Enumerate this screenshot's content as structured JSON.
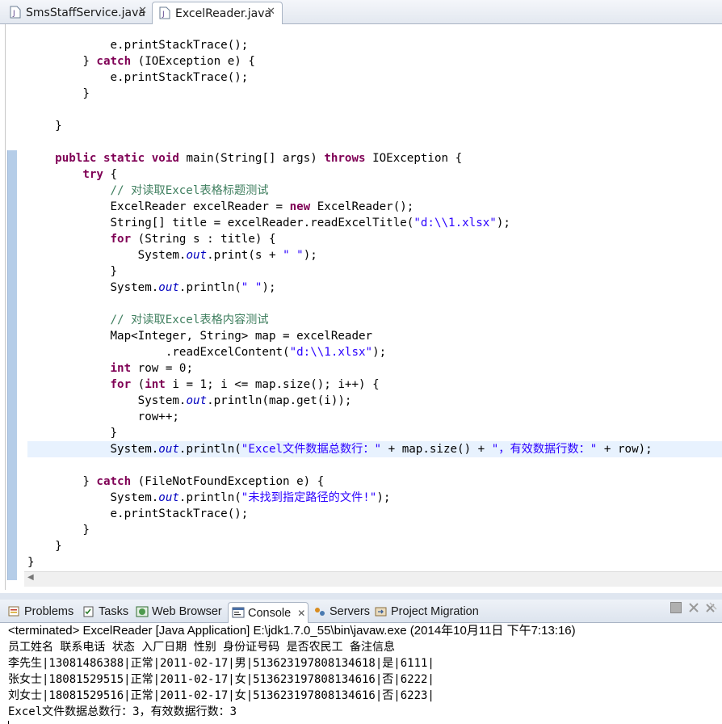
{
  "editor_tabs": [
    {
      "label": "SmsStaffService.java",
      "close": "✕",
      "icon": "java-file-icon",
      "active": false
    },
    {
      "label": "ExcelReader.java",
      "close": "✕",
      "icon": "java-file-icon",
      "active": true
    }
  ],
  "code_lines": [
    "            e.printStackTrace();",
    "        } catch (IOException e) {",
    "            e.printStackTrace();",
    "        }",
    "",
    "    }",
    "",
    "    public static void main(String[] args) throws IOException {",
    "        try {",
    "            // 对读取Excel表格标题测试",
    "            ExcelReader excelReader = new ExcelReader();",
    "            String[] title = excelReader.readExcelTitle(\"d:\\\\1.xlsx\");",
    "            for (String s : title) {",
    "                System.out.print(s + \" \");",
    "            }",
    "            System.out.println(\" \");",
    "",
    "            // 对读取Excel表格内容测试",
    "            Map<Integer, String> map = excelReader",
    "                    .readExcelContent(\"d:\\\\1.xlsx\");",
    "            int row = 0;",
    "            for (int i = 1; i <= map.size(); i++) {",
    "                System.out.println(map.get(i));",
    "                row++;",
    "            }",
    "            System.out.println(\"Excel文件数据总数行：\" + map.size() + \"，有效数据行数：\" + row);",
    "",
    "        } catch (FileNotFoundException e) {",
    "            System.out.println(\"未找到指定路径的文件!\");",
    "            e.printStackTrace();",
    "        }",
    "    }",
    "}"
  ],
  "highlighted_line": 25,
  "view_tabs": [
    {
      "label": "Problems",
      "icon": "problems-icon"
    },
    {
      "label": "Tasks",
      "icon": "tasks-icon"
    },
    {
      "label": "Web Browser",
      "icon": "web-browser-icon"
    },
    {
      "label": "Console",
      "icon": "console-icon",
      "active": true,
      "close": "✕"
    },
    {
      "label": "Servers",
      "icon": "servers-icon"
    },
    {
      "label": "Project Migration",
      "icon": "project-migration-icon"
    }
  ],
  "console": {
    "status": "<terminated> ExcelReader [Java Application] E:\\jdk1.7.0_55\\bin\\javaw.exe (2014年10月11日 下午7:13:16)",
    "output": [
      "员工姓名 联系电话 状态 入厂日期 性别 身份证号码 是否农民工 备注信息",
      "李先生|13081486388|正常|2011-02-17|男|513623197808134618|是|6111|",
      "张女士|18081529515|正常|2011-02-17|女|513623197808134616|否|6222|",
      "刘女士|18081529516|正常|2011-02-17|女|513623197808134616|否|6223|",
      "Excel文件数据总数行：3，有效数据行数：3"
    ]
  },
  "colors": {
    "keyword": "#7f0055",
    "comment": "#3f7f5f",
    "string": "#2a00ff",
    "static_field": "#0000c0",
    "line_highlight": "#e8f2fe"
  }
}
